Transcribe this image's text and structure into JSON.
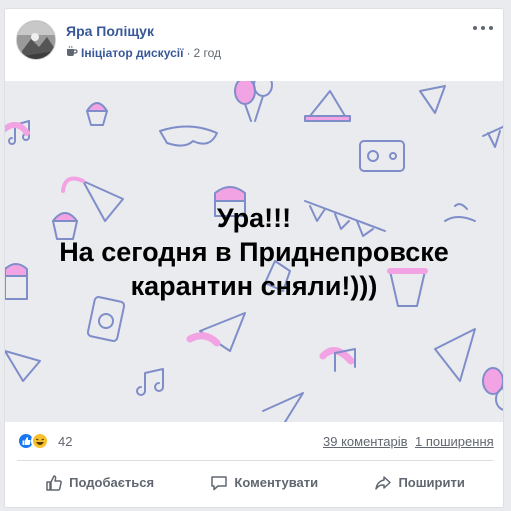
{
  "post": {
    "author": "Яра Поліщук",
    "role_icon": "coffee-cup-icon",
    "role": "Ініціатор дискусії",
    "separator": "·",
    "time": "2 год",
    "text": "Ура!!!\nНа сегодня в Приднепровске\nкарантин сняли!)))",
    "background_color": "#eaebef"
  },
  "reactions": {
    "icons": [
      "like-icon",
      "haha-icon"
    ],
    "count": "42",
    "comments": "39 коментарів",
    "shares": "1 поширення"
  },
  "actions": {
    "like": "Подобається",
    "comment": "Коментувати",
    "share": "Поширити"
  },
  "colors": {
    "link": "#385898",
    "like_blue": "#1877f2",
    "haha_yellow": "#f7c02e",
    "doodle_blue": "#7f8ec9",
    "doodle_pink": "#f2a3e3"
  }
}
